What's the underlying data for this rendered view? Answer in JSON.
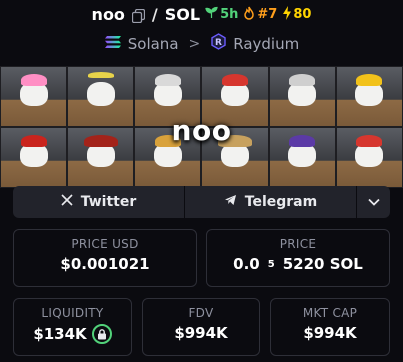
{
  "token": {
    "symbol": "noo",
    "quote": "SOL",
    "separator": "/",
    "age": "5h",
    "rank": "#7",
    "boosts": "80"
  },
  "chain": {
    "name": "Solana",
    "dex": "Raydium"
  },
  "banner": {
    "title": "noo"
  },
  "links": {
    "twitter_label": "Twitter",
    "telegram_label": "Telegram"
  },
  "stats": {
    "price_usd_label": "PRICE USD",
    "price_usd_value": "$0.001021",
    "price_label": "PRICE",
    "price_prefix": "0.0",
    "price_zeros": "5",
    "price_digits": "5220 SOL",
    "liquidity_label": "LIQUIDITY",
    "liquidity_value": "$134K",
    "fdv_label": "FDV",
    "fdv_value": "$994K",
    "mktcap_label": "MKT CAP",
    "mktcap_value": "$994K"
  },
  "colors": {
    "age": "#52d27a",
    "rank": "#ff9f1c",
    "boost": "#ffd400",
    "background": "#0b0b10",
    "card_border": "#2e2f38"
  },
  "icons": {
    "copy": "copy-icon",
    "age": "seedling-icon",
    "rank": "flame-icon",
    "boost": "lightning-icon",
    "chain": "solana-icon",
    "dex": "raydium-icon",
    "twitter": "x-icon",
    "telegram": "paper-plane-icon",
    "more": "chevron-down-icon",
    "lock": "lock-icon"
  }
}
